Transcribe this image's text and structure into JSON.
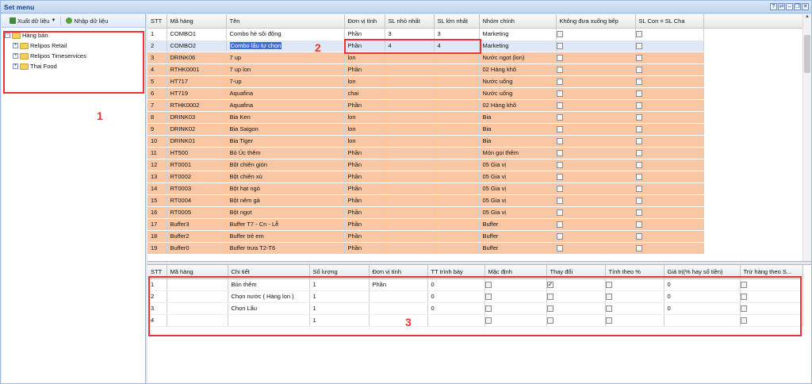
{
  "window": {
    "title": "Set menu",
    "buttons": [
      "?",
      "⇄",
      "–",
      "❐",
      "✕"
    ]
  },
  "left_toolbar": {
    "export_label": "Xuất dữ liệu",
    "import_label": "Nhập dữ liệu"
  },
  "tree": {
    "root": "Hàng bán",
    "children": [
      "Relipos Retail",
      "Relipos Timeservices",
      "Thai Food"
    ]
  },
  "annotations": {
    "label1": "1",
    "label2": "2",
    "label3": "3"
  },
  "grid_top": {
    "headers": [
      "STT",
      "Mã hàng",
      "Tên",
      "Đơn vị tính",
      "SL nhỏ nhất",
      "SL lớn nhất",
      "Nhóm chính",
      "Không đưa xuống bếp",
      "SL Con = SL Cha"
    ],
    "rows": [
      [
        "1",
        "COMBO1",
        "Combo hè sôi động",
        "Phần",
        "3",
        "3",
        "Marketing"
      ],
      [
        "2",
        "COMBO2",
        "Combo lẩu tự chọn",
        "Phần",
        "4",
        "4",
        "Marketing"
      ],
      [
        "3",
        "DRINK06",
        "7 up",
        "lon",
        "",
        "",
        "Nước ngọt (lon)"
      ],
      [
        "4",
        "RTHK0001",
        "7 up lon",
        "Phần",
        "",
        "",
        "02 Hàng khô"
      ],
      [
        "5",
        "HT717",
        "7-up",
        "lon",
        "",
        "",
        "Nước uống"
      ],
      [
        "6",
        "HT719",
        "Aquafina",
        "chai",
        "",
        "",
        "Nước uống"
      ],
      [
        "7",
        "RTHK0002",
        "Aquafina",
        "Phần",
        "",
        "",
        "02 Hàng khô"
      ],
      [
        "8",
        "DRINK03",
        "Bia Ken",
        "lon",
        "",
        "",
        "Bia"
      ],
      [
        "9",
        "DRINK02",
        "Bia Saigon",
        "lon",
        "",
        "",
        "Bia"
      ],
      [
        "10",
        "DRINK01",
        "Bia Tiger",
        "lon",
        "",
        "",
        "Bia"
      ],
      [
        "11",
        "HT500",
        "Bò Úc thêm",
        "Phần",
        "",
        "",
        "Món gọi thêm"
      ],
      [
        "12",
        "RT0001",
        "Bột chiên giòn",
        "Phần",
        "",
        "",
        "05 Gia vị"
      ],
      [
        "13",
        "RT0002",
        "Bột chiên xù",
        "Phần",
        "",
        "",
        "05 Gia vị"
      ],
      [
        "14",
        "RT0003",
        "Bột hạt ngò",
        "Phần",
        "",
        "",
        "05 Gia vị"
      ],
      [
        "15",
        "RT0004",
        "Bột nêm gà",
        "Phần",
        "",
        "",
        "05 Gia vị"
      ],
      [
        "16",
        "RT0005",
        "Bột ngọt",
        "Phần",
        "",
        "",
        "05 Gia vị"
      ],
      [
        "17",
        "Buffer3",
        "Buffer T7 - Cn - Lễ",
        "Phần",
        "",
        "",
        "Buffer"
      ],
      [
        "18",
        "Buffer2",
        "Buffer trẻ em",
        "Phần",
        "",
        "",
        "Buffer"
      ],
      [
        "19",
        "Buffer0",
        "Buffer trưa T2-T6",
        "Phần",
        "",
        "",
        "Buffer"
      ]
    ]
  },
  "grid_bottom": {
    "headers": [
      "STT",
      "Mã hàng",
      "Chi tiết",
      "Số lượng",
      "Đơn vị tính",
      "TT trình bày",
      "Mặc định",
      "Thay đổi",
      "Tính theo %",
      "Giá trị(% hay số tiền)",
      "Trừ hàng theo S..."
    ],
    "rows": [
      {
        "stt": "1",
        "code": "",
        "detail": "Bún thêm",
        "qty": "1",
        "unit": "Phần",
        "order": "0",
        "default": false,
        "change": true,
        "percent": false,
        "value": "0"
      },
      {
        "stt": "2",
        "code": "",
        "detail": "Chọn nước ( Hàng lon )",
        "qty": "1",
        "unit": "",
        "order": "0",
        "default": false,
        "change": false,
        "percent": false,
        "value": "0"
      },
      {
        "stt": "3",
        "code": "",
        "detail": "Chọn Lẩu",
        "qty": "1",
        "unit": "",
        "order": "0",
        "default": false,
        "change": false,
        "percent": false,
        "value": "0"
      },
      {
        "stt": "4",
        "code": "",
        "detail": "",
        "qty": "1",
        "unit": "",
        "order": "",
        "default": false,
        "change": false,
        "percent": false,
        "value": ""
      }
    ]
  },
  "colors": {
    "row_highlight": "#f9c7a3",
    "annotation_red": "#e33",
    "header_blue": "#15428b"
  }
}
